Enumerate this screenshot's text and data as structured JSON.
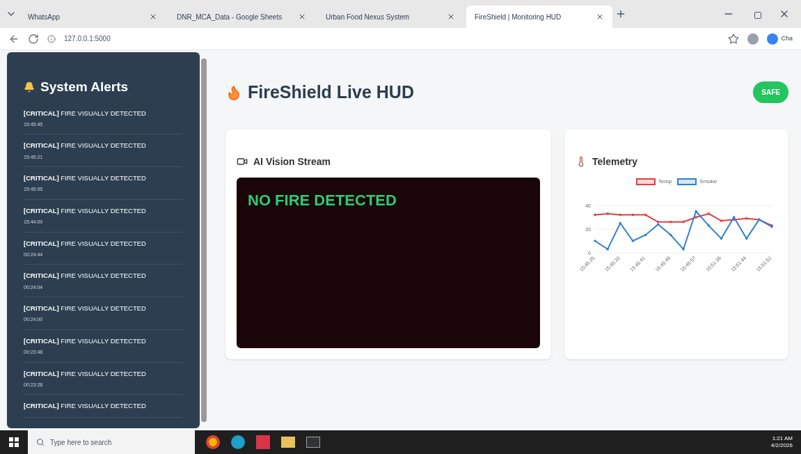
{
  "browser": {
    "tabs": [
      {
        "title": "WhatsApp",
        "selected": false
      },
      {
        "title": "DNR_MCA_Data - Google Sheets",
        "selected": false
      },
      {
        "title": "Urban Food Nexus System",
        "selected": false
      },
      {
        "title": "FireShield | Monitoring HUD",
        "selected": true
      }
    ],
    "address": "127.0.0.1:5000",
    "profile_label": "Cha"
  },
  "sidebar": {
    "title": "System Alerts",
    "alerts": [
      {
        "level": "[CRITICAL]",
        "message": "FIRE VISUALLY DETECTED",
        "time": "15:45:45"
      },
      {
        "level": "[CRITICAL]",
        "message": "FIRE VISUALLY DETECTED",
        "time": "15:45:21"
      },
      {
        "level": "[CRITICAL]",
        "message": "FIRE VISUALLY DETECTED",
        "time": "15:45:05"
      },
      {
        "level": "[CRITICAL]",
        "message": "FIRE VISUALLY DETECTED",
        "time": "15:44:09"
      },
      {
        "level": "[CRITICAL]",
        "message": "FIRE VISUALLY DETECTED",
        "time": "00:24:44"
      },
      {
        "level": "[CRITICAL]",
        "message": "FIRE VISUALLY DETECTED",
        "time": "00:24:04"
      },
      {
        "level": "[CRITICAL]",
        "message": "FIRE VISUALLY DETECTED",
        "time": "00:24:00"
      },
      {
        "level": "[CRITICAL]",
        "message": "FIRE VISUALLY DETECTED",
        "time": "00:23:48"
      },
      {
        "level": "[CRITICAL]",
        "message": "FIRE VISUALLY DETECTED",
        "time": "00:23:28"
      },
      {
        "level": "[CRITICAL]",
        "message": "FIRE VISUALLY DETECTED"
      }
    ]
  },
  "header": {
    "title": "FireShield Live HUD",
    "status": "SAFE",
    "alarm": false
  },
  "vision": {
    "title": "AI Vision Stream",
    "overlay": "NO FIRE DETECTED",
    "fire": false
  },
  "telemetry": {
    "title": "Telemetry",
    "chart_data": {
      "type": "line",
      "categories": [
        "15:45:25",
        null,
        "15:45:33",
        null,
        "15:45:41",
        null,
        "15:45:49",
        null,
        "15:45:57",
        null,
        "15:51:36",
        null,
        "15:51:44",
        null,
        "15:51:52"
      ],
      "legend": "top",
      "ylim": [
        0,
        40
      ],
      "yticks": [
        0,
        20,
        40
      ],
      "series": [
        {
          "name": "Temp",
          "color": "#e53e3e",
          "values": [
            32,
            33,
            32,
            32,
            32,
            26,
            26,
            26,
            30,
            33,
            27,
            28,
            29,
            28,
            23
          ]
        },
        {
          "name": "Smoke",
          "color": "#3182ce",
          "values": [
            10,
            3,
            25,
            10,
            15,
            24,
            15,
            3,
            35,
            23,
            12,
            30,
            12,
            28,
            22
          ]
        }
      ]
    }
  },
  "taskbar": {
    "search_placeholder": "Type here to search",
    "time": "1:21 AM",
    "date": "4/2/2026"
  }
}
